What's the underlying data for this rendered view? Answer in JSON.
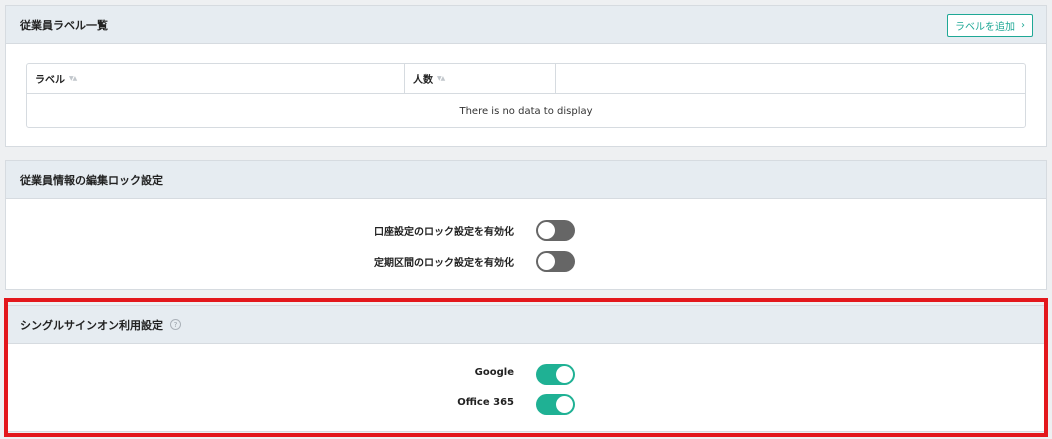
{
  "labels_card": {
    "title": "従業員ラベル一覧",
    "add_button": "ラベルを追加",
    "columns": [
      "ラベル",
      "人数",
      ""
    ],
    "empty_message": "There is no data to display"
  },
  "lock_card": {
    "title": "従業員情報の編集ロック設定",
    "settings": [
      {
        "label": "口座設定のロック設定を有効化",
        "enabled": false
      },
      {
        "label": "定期区間のロック設定を有効化",
        "enabled": false
      }
    ]
  },
  "sso_card": {
    "title": "シングルサインオン利用設定",
    "help_glyph": "?",
    "settings": [
      {
        "label": "Google",
        "enabled": true
      },
      {
        "label": "Office 365",
        "enabled": true
      }
    ]
  },
  "colors": {
    "accent": "#1fa896",
    "toggle_on": "#1fb194",
    "toggle_off": "#666666",
    "highlight": "#e3171c"
  }
}
